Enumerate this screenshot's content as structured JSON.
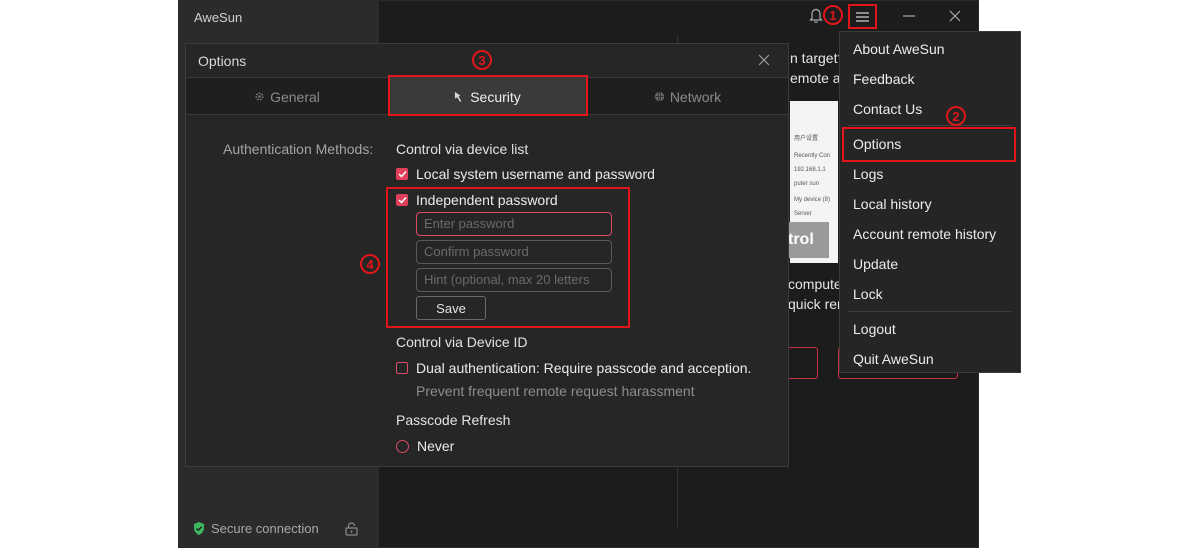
{
  "app": {
    "title": "AweSun",
    "secure_text": "Secure connection",
    "bg": {
      "line1": "n target?",
      "line2": "emote ac",
      "line3": "compute",
      "line4": "quick ren",
      "control": "trol",
      "shot_lines": [
        "用户设置",
        "Recently Con",
        "192.168.1.1",
        "puter sun",
        "My device (8)",
        "Server"
      ]
    }
  },
  "markers": {
    "m1": "1",
    "m2": "2",
    "m3": "3",
    "m4": "4"
  },
  "menu": {
    "items": [
      "About AweSun",
      "Feedback",
      "Contact Us",
      "Options",
      "Logs",
      "Local history",
      "Account remote history",
      "Update",
      "Lock",
      "Logout",
      "Quit AweSun"
    ]
  },
  "dialog": {
    "title": "Options",
    "tabs": [
      {
        "label": "General",
        "icon": "gear-icon"
      },
      {
        "label": "Security",
        "icon": "security-icon"
      },
      {
        "label": "Network",
        "icon": "globe-icon"
      }
    ],
    "auth_label": "Authentication Methods:",
    "section_device_list": "Control via device list",
    "opt_local": "Local system username and password",
    "opt_independent": "Independent password",
    "placeholders": {
      "password": "Enter password",
      "confirm": "Confirm password",
      "hint": "Hint (optional, max 20 letters"
    },
    "save": "Save",
    "section_device_id": "Control via Device ID",
    "opt_dual": "Dual authentication: Require passcode and acception.",
    "dual_note": "Prevent frequent remote request harassment",
    "section_refresh": "Passcode Refresh",
    "opt_never": "Never"
  },
  "colors": {
    "accent": "#e0405a",
    "marker": "#e0161b",
    "bg": "#1c1c1c"
  }
}
